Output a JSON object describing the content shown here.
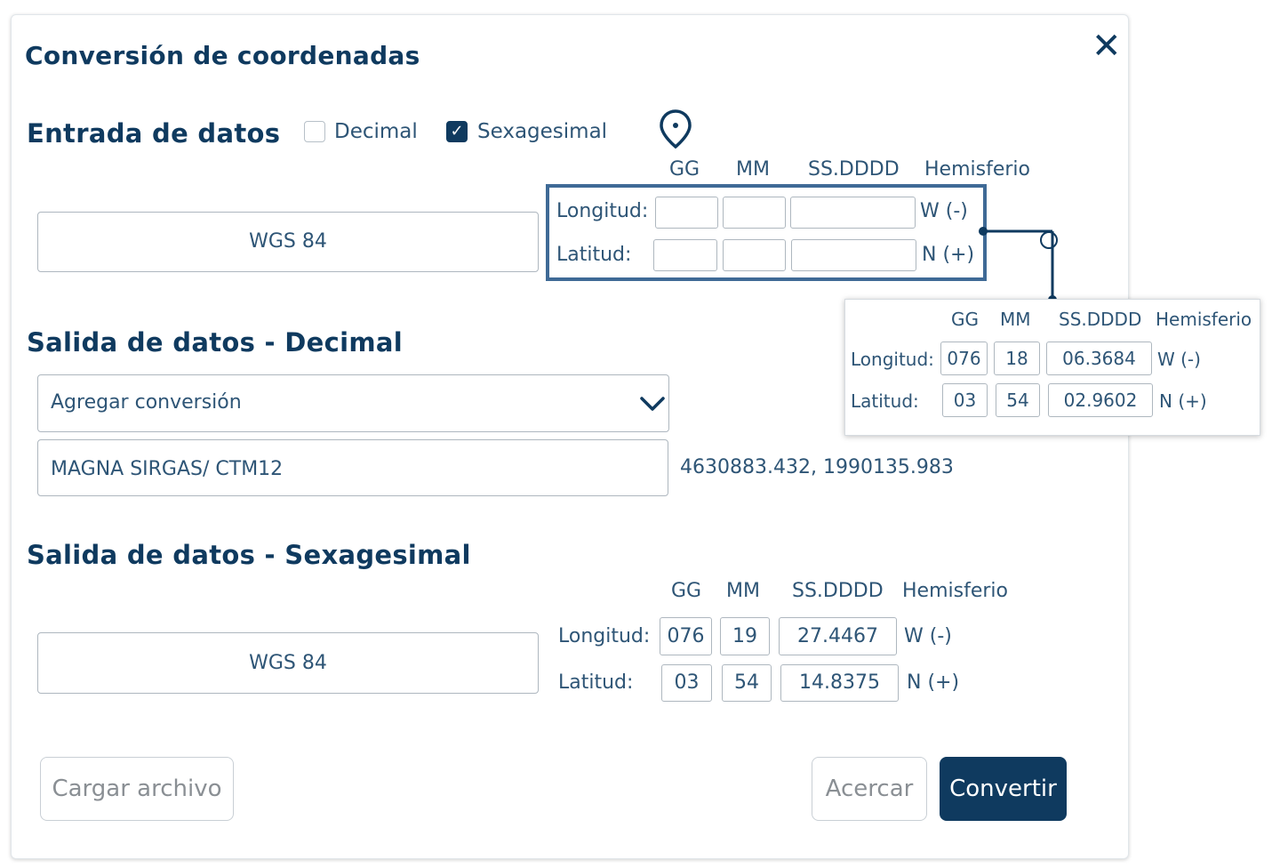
{
  "dialog": {
    "title": "Conversión de coordenadas",
    "close_icon": "close-icon"
  },
  "entrada": {
    "heading": "Entrada de datos",
    "decimal_label": "Decimal",
    "decimal_checked": false,
    "sexagesimal_label": "Sexagesimal",
    "sexagesimal_checked": true,
    "location_icon": "map-pin-icon",
    "datum": "WGS 84",
    "columns": [
      "GG",
      "MM",
      "SS.DDDD",
      "Hemisferio"
    ],
    "longitud_label": "Longitud:",
    "latitud_label": "Latitud:",
    "longitud": {
      "gg": "",
      "mm": "",
      "ss": "",
      "hemisferio": "W (-)"
    },
    "latitud": {
      "gg": "",
      "mm": "",
      "ss": "",
      "hemisferio": "N (+)"
    }
  },
  "example": {
    "columns": [
      "GG",
      "MM",
      "SS.DDDD",
      "Hemisferio"
    ],
    "longitud_label": "Longitud:",
    "latitud_label": "Latitud:",
    "longitud": {
      "gg": "076",
      "mm": "18",
      "ss": "06.3684",
      "hemisferio": "W (-)"
    },
    "latitud": {
      "gg": "03",
      "mm": "54",
      "ss": "02.9602",
      "hemisferio": "N (+)"
    }
  },
  "salida_decimal": {
    "heading": "Salida de datos - Decimal",
    "dropdown_value": "Agregar conversión",
    "dropdown_icon": "chevron-down-icon",
    "system": "MAGNA SIRGAS/ CTM12",
    "result": "4630883.432, 1990135.983"
  },
  "salida_sexagesimal": {
    "heading": "Salida de datos - Sexagesimal",
    "datum": "WGS 84",
    "columns": [
      "GG",
      "MM",
      "SS.DDDD",
      "Hemisferio"
    ],
    "longitud_label": "Longitud:",
    "latitud_label": "Latitud:",
    "longitud": {
      "gg": "076",
      "mm": "19",
      "ss": "27.4467",
      "hemisferio": "W (-)"
    },
    "latitud": {
      "gg": "03",
      "mm": "54",
      "ss": "14.8375",
      "hemisferio": "N (+)"
    }
  },
  "actions": {
    "cargar": "Cargar archivo",
    "acercar": "Acercar",
    "convertir": "Convertir"
  },
  "colors": {
    "primary": "#0f3a5f",
    "highlight": "#3f6a96"
  }
}
